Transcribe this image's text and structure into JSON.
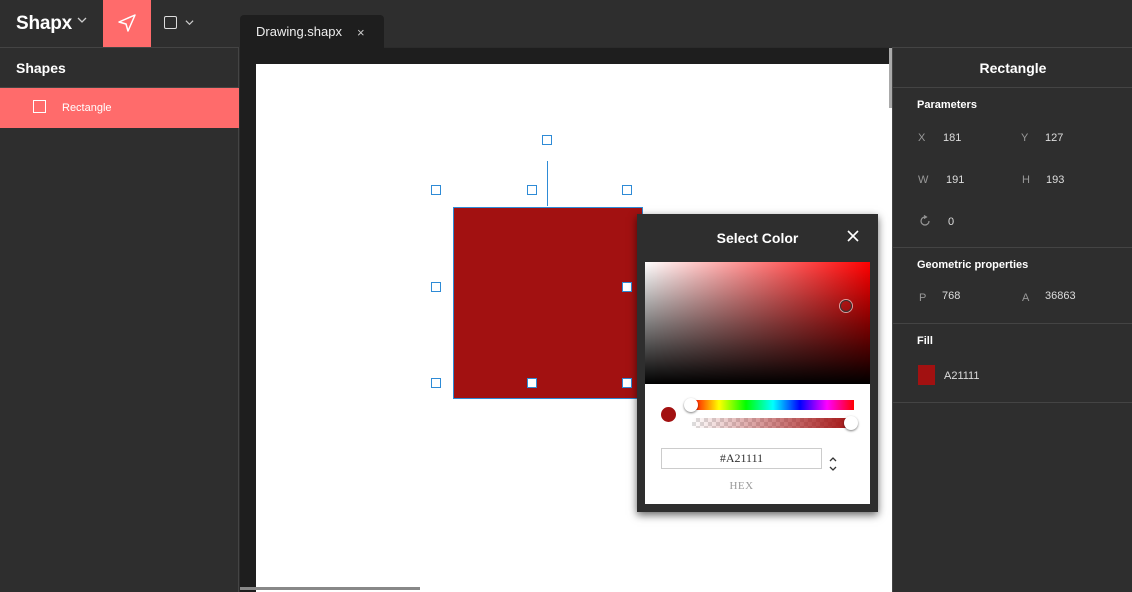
{
  "app": {
    "name": "Shapx"
  },
  "tab": {
    "label": "Drawing.shapx",
    "close": "×"
  },
  "shapes_panel": {
    "title": "Shapes",
    "items": [
      {
        "label": "Rectangle"
      }
    ]
  },
  "properties": {
    "title": "Rectangle",
    "parameters": {
      "title": "Parameters",
      "x_label": "X",
      "x_value": "181",
      "y_label": "Y",
      "y_value": "127",
      "w_label": "W",
      "w_value": "191",
      "h_label": "H",
      "h_value": "193",
      "rotation_value": "0"
    },
    "geometric": {
      "title": "Geometric properties",
      "p_label": "P",
      "p_value": "768",
      "a_label": "A",
      "a_value": "36863"
    },
    "fill": {
      "title": "Fill",
      "value": "A21111",
      "color": "#A21111"
    }
  },
  "color_picker": {
    "title": "Select Color",
    "hex_value": "#A21111",
    "mode_label": "HEX"
  },
  "colors": {
    "accent": "#FF6B6B",
    "shape_fill": "#A21111",
    "selection": "#2E8BD6"
  },
  "icons": [
    "chevron-down-icon",
    "send-icon",
    "square-icon",
    "close-icon",
    "rotate-icon",
    "stepper-icon"
  ]
}
